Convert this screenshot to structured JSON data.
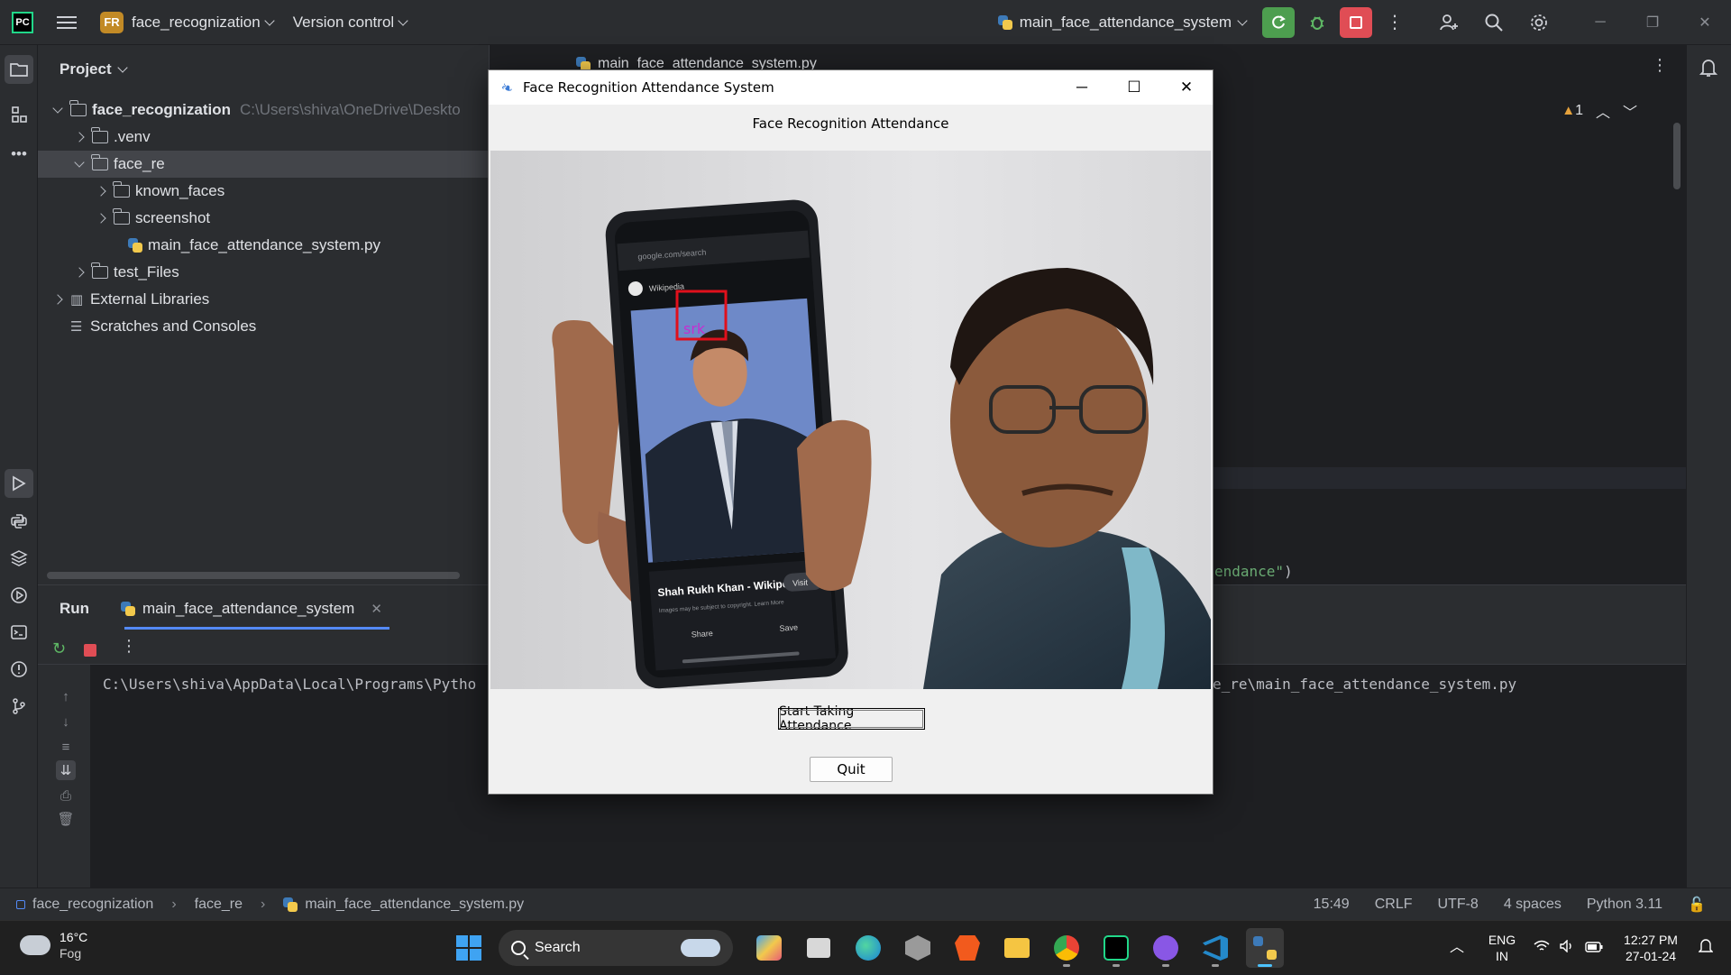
{
  "titlebar": {
    "project_badge": "FR",
    "project_name": "face_recognization",
    "vcs_label": "Version control",
    "run_config": "main_face_attendance_system"
  },
  "project_panel": {
    "title": "Project",
    "tree": [
      {
        "label": "face_recognization",
        "hint": "C:\\Users\\shiva\\OneDrive\\Deskto"
      },
      {
        "label": ".venv"
      },
      {
        "label": "face_re"
      },
      {
        "label": "known_faces"
      },
      {
        "label": "screenshot"
      },
      {
        "label": "main_face_attendance_system.py"
      },
      {
        "label": "test_Files"
      },
      {
        "label": "External Libraries"
      },
      {
        "label": "Scratches and Consoles"
      }
    ]
  },
  "editor": {
    "tab_label": "main_face_attendance_system.py",
    "warning_count": "1",
    "code_fragment_string": "endance\"",
    "code_fragment_tail": ")"
  },
  "run_panel": {
    "title": "Run",
    "tab_label": "main_face_attendance_system",
    "console_left": "C:\\Users\\shiva\\AppData\\Local\\Programs\\Pytho",
    "console_right": "e_re\\main_face_attendance_system.py"
  },
  "statusbar": {
    "crumbs": [
      "face_recognization",
      "face_re",
      "main_face_attendance_system.py"
    ],
    "position": "15:49",
    "line_sep": "CRLF",
    "encoding": "UTF-8",
    "indent": "4 spaces",
    "interpreter": "Python 3.11"
  },
  "app_window": {
    "title": "Face Recognition Attendance System",
    "heading": "Face Recognition Attendance",
    "face_label": "srk",
    "phone_caption": "Shah Rukh Khan - Wikipedia",
    "phone_visit": "Visit",
    "phone_copyright": "Images may be subject to copyright. Learn More",
    "phone_share": "Share",
    "phone_save": "Save",
    "phone_site": "Wikipedia",
    "phone_url": "google.com/search",
    "start_button": "Start Taking Attendance",
    "quit_button": "Quit",
    "colors": {
      "face_box": "#e0101c",
      "face_label": "#c42fd1"
    }
  },
  "taskbar": {
    "weather_temp": "16°C",
    "weather_desc": "Fog",
    "search_label": "Search",
    "lang_top": "ENG",
    "lang_bottom": "IN",
    "time": "12:27 PM",
    "date": "27-01-24"
  }
}
